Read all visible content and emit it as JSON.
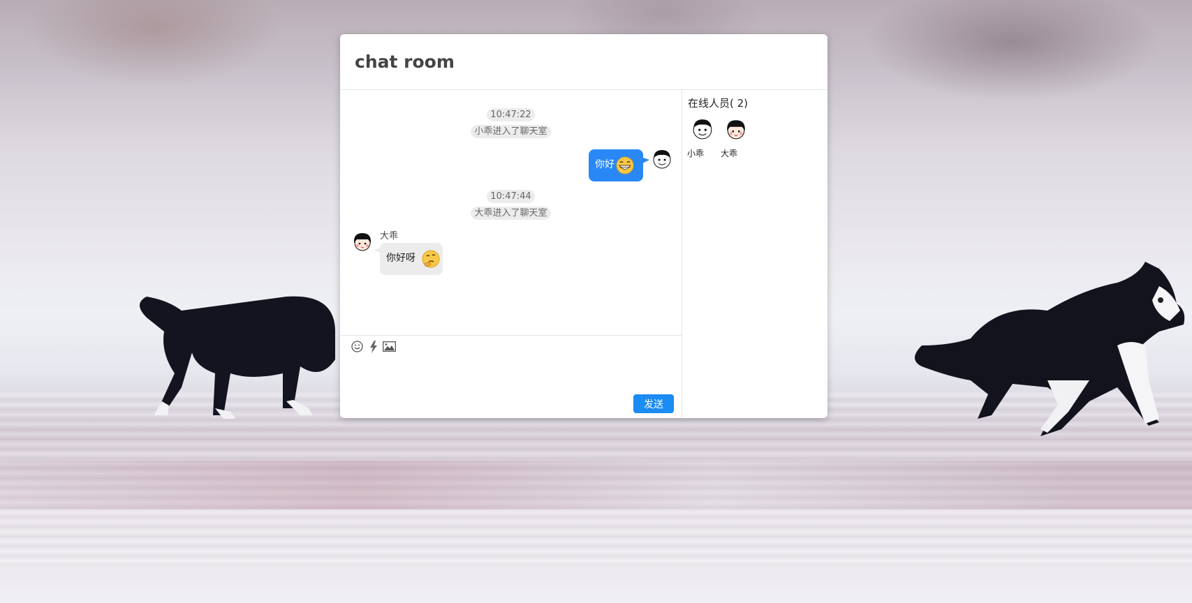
{
  "header": {
    "title": "chat room"
  },
  "messages": {
    "entries": [
      {
        "time": "10:47:22",
        "note": "小乖进入了聊天室"
      },
      {
        "time": "10:47:44",
        "note": "大乖进入了聊天室"
      }
    ],
    "outgoing": {
      "text": "你好",
      "emoji": "grinning-emoji"
    },
    "incoming": {
      "sender": "大乖",
      "text": "你好呀",
      "emoji": "thinking-emoji"
    }
  },
  "composer": {
    "tools": [
      "smile-icon",
      "lightning-icon",
      "image-icon"
    ],
    "input_value": "",
    "send_label": "发送"
  },
  "online": {
    "title": "在线人员( 2)",
    "users": [
      {
        "name": "小乖",
        "avatar": "boy-avatar"
      },
      {
        "name": "大乖",
        "avatar": "girl-avatar"
      }
    ]
  },
  "colors": {
    "accent": "#1c8bf3",
    "bubble_me": "#2988f6",
    "bubble_other": "#ececec"
  }
}
